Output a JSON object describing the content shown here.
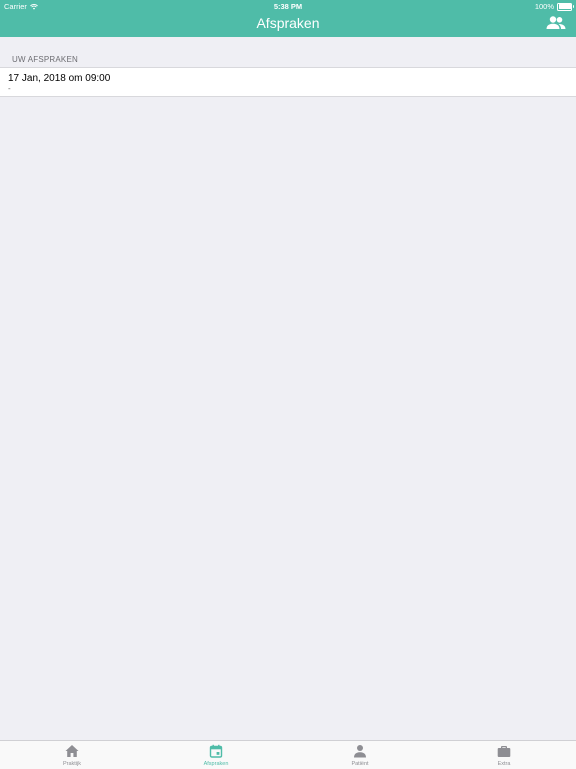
{
  "status_bar": {
    "carrier": "Carrier",
    "time": "5:38 PM",
    "battery": "100%",
    "battery_level": 1.0
  },
  "nav": {
    "title": "Afspraken",
    "right_icon": "contacts-icon"
  },
  "section": {
    "header": "UW AFSPRAKEN"
  },
  "appointments": [
    {
      "date": "17 Jan, 2018 om 09:00",
      "detail": "-"
    }
  ],
  "tabs": [
    {
      "label": "Praktijk",
      "icon": "home-icon",
      "active": false
    },
    {
      "label": "Afspraken",
      "icon": "calendar-icon",
      "active": true
    },
    {
      "label": "Patiënt",
      "icon": "person-icon",
      "active": false
    },
    {
      "label": "Extra",
      "icon": "briefcase-icon",
      "active": false
    }
  ],
  "colors": {
    "accent": "#4fbca8",
    "background": "#efeff4",
    "inactive": "#8e8e93"
  }
}
